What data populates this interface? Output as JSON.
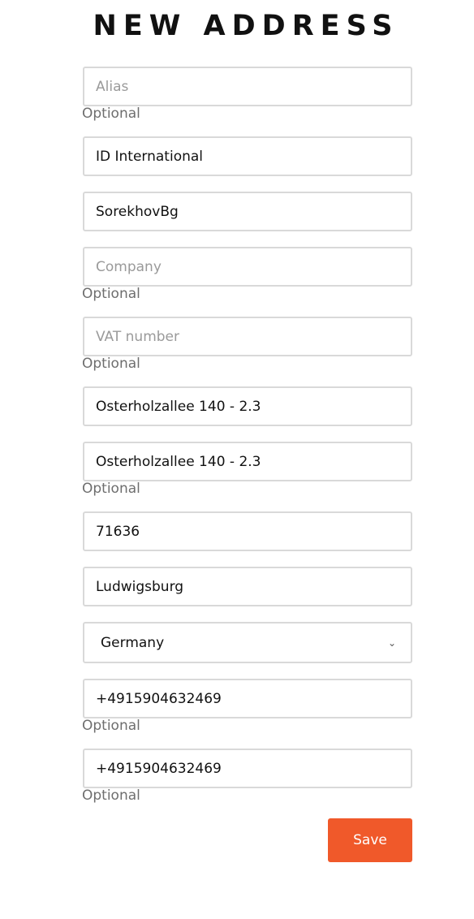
{
  "page": {
    "title": "NEW ADDRESS"
  },
  "form": {
    "alias": {
      "value": "",
      "placeholder": "Alias",
      "hint": "Optional"
    },
    "first_name": {
      "value": "ID International",
      "placeholder": ""
    },
    "last_name": {
      "value": "SorekhovBg",
      "placeholder": ""
    },
    "company": {
      "value": "",
      "placeholder": "Company",
      "hint": "Optional"
    },
    "vat_number": {
      "value": "",
      "placeholder": "VAT number",
      "hint": "Optional"
    },
    "address": {
      "value": "Osterholzallee 140 - 2.3",
      "placeholder": ""
    },
    "address_complement": {
      "value": "Osterholzallee 140 - 2.3",
      "placeholder": "",
      "hint": "Optional"
    },
    "postcode": {
      "value": "71636",
      "placeholder": ""
    },
    "city": {
      "value": "Ludwigsburg",
      "placeholder": ""
    },
    "country": {
      "value": "Germany",
      "icon": "chevron-down-icon"
    },
    "phone": {
      "value": "+4915904632469",
      "placeholder": "",
      "hint": "Optional"
    },
    "mobile_phone": {
      "value": "+4915904632469",
      "placeholder": "",
      "hint": "Optional"
    },
    "save_label": "Save"
  },
  "colors": {
    "accent": "#f0592a",
    "field_border": "#d9d9d9",
    "hint_text": "#6e6e6e"
  }
}
